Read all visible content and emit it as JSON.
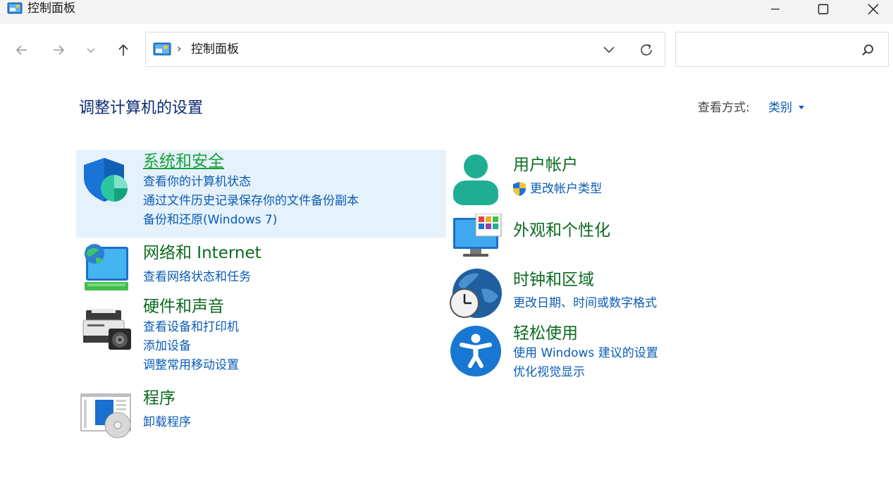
{
  "window": {
    "title": "控制面板"
  },
  "address": {
    "path": "控制面板",
    "separator": "›"
  },
  "search": {
    "placeholder": ""
  },
  "heading": "调整计算机的设置",
  "view_by": {
    "label": "查看方式:",
    "value": "类别"
  },
  "categories": {
    "system_security": {
      "title": "系统和安全",
      "links": [
        "查看你的计算机状态",
        "通过文件历史记录保存你的文件备份副本",
        "备份和还原(Windows 7)"
      ]
    },
    "network": {
      "title": "网络和 Internet",
      "links": [
        "查看网络状态和任务"
      ]
    },
    "hardware": {
      "title": "硬件和声音",
      "links": [
        "查看设备和打印机",
        "添加设备",
        "调整常用移动设置"
      ]
    },
    "programs": {
      "title": "程序",
      "links": [
        "卸载程序"
      ]
    },
    "user_accounts": {
      "title": "用户帐户",
      "links": [
        "更改帐户类型"
      ]
    },
    "appearance": {
      "title": "外观和个性化",
      "links": []
    },
    "clock_region": {
      "title": "时钟和区域",
      "links": [
        "更改日期、时间或数字格式"
      ]
    },
    "ease_of_access": {
      "title": "轻松使用",
      "links": [
        "使用 Windows 建议的设置",
        "优化视觉显示"
      ]
    }
  },
  "colors": {
    "category_title": "#0b6a1f",
    "link": "#0a5bb5",
    "heading": "#0b2a73",
    "hover_bg": "#e5f1fb",
    "hover_title": "#17a23b"
  }
}
